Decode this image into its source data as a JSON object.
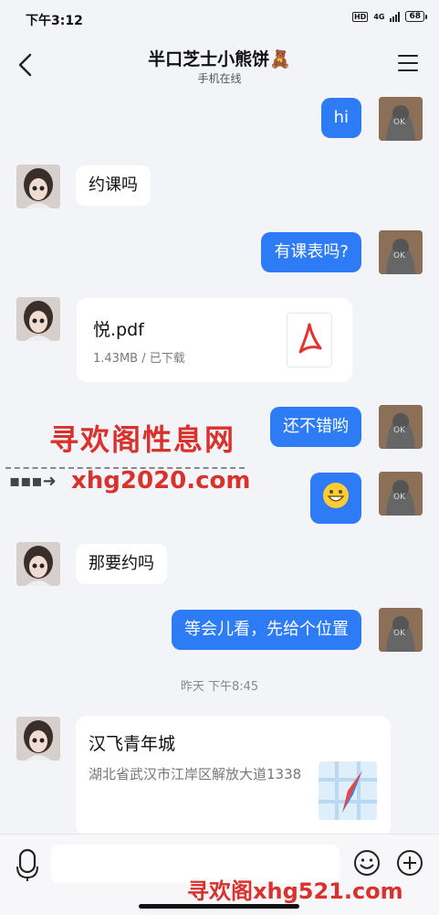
{
  "status_bar": {
    "time": "下午3:12",
    "hd": "HD",
    "network": "4G",
    "battery": "68"
  },
  "header": {
    "title": "半口芝士小熊饼🧸",
    "subtitle": "手机在线",
    "back_icon": "chevron-left-icon",
    "menu_icon": "hamburger-menu-icon"
  },
  "messages": [
    {
      "side": "out",
      "text": "hi"
    },
    {
      "side": "in",
      "text": "约课吗"
    },
    {
      "side": "out",
      "text": "有课表吗?"
    },
    {
      "side": "in",
      "type": "file",
      "file_name": "悦.pdf",
      "file_meta": "1.43MB / 已下载",
      "icon": "pdf-icon"
    },
    {
      "side": "out",
      "text": "还不错哟"
    },
    {
      "side": "out",
      "type": "emoji",
      "text": "😁"
    },
    {
      "side": "in",
      "text": "那要约吗"
    },
    {
      "side": "out",
      "text": "等会儿看，先给个位置"
    },
    {
      "side": "in",
      "type": "location",
      "title": "汉飞青年城",
      "address": "湖北省武汉市江岸区解放大道1338",
      "icon": "map-pin-icon"
    }
  ],
  "timestamp": "昨天 下午8:45",
  "watermark": {
    "title": "寻欢阁性息网",
    "url": "xhg2020.com",
    "bottom": "寻欢阁xhg521.com"
  },
  "input_bar": {
    "placeholder": "",
    "mic_icon": "microphone-icon",
    "emoji_icon": "smiley-icon",
    "plus_icon": "plus-circle-icon"
  },
  "colors": {
    "outgoing_bubble": "#2d7cf6",
    "background": "#f3f4f7",
    "watermark": "#d9312c"
  }
}
